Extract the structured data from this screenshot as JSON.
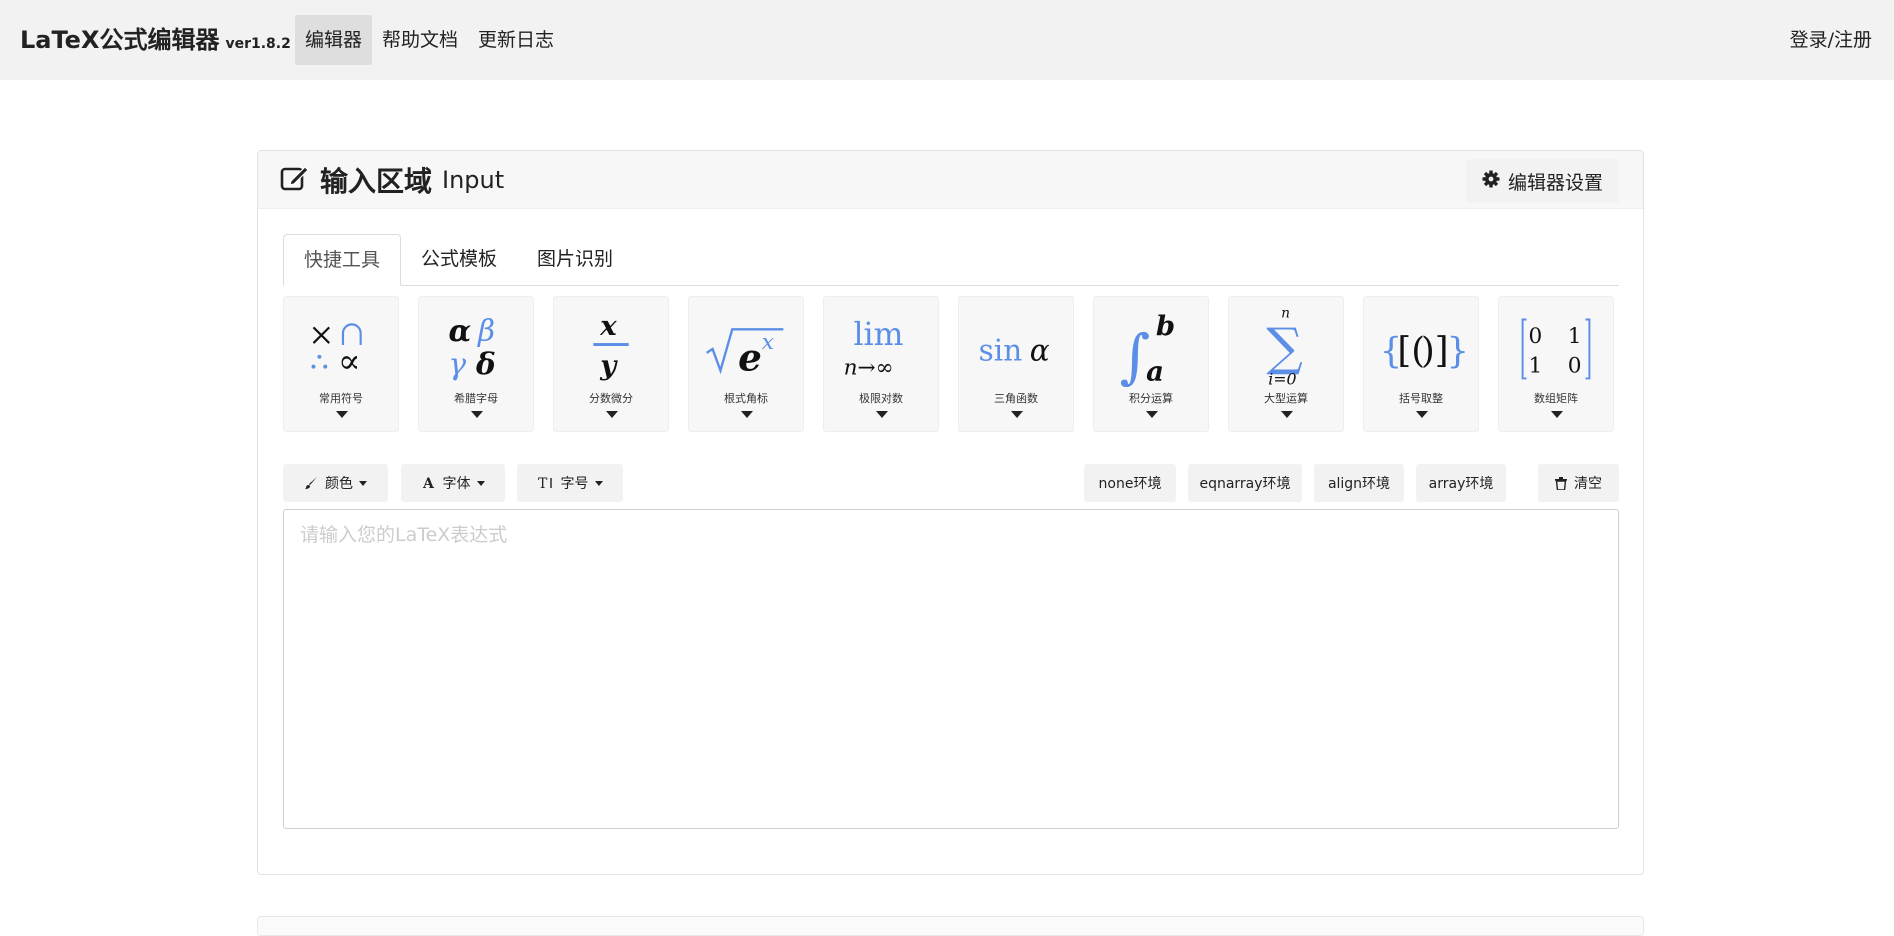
{
  "nav": {
    "brand_title": "LaTeX公式编辑器",
    "brand_version": "ver1.8.2",
    "links": [
      {
        "label": "编辑器",
        "active": true
      },
      {
        "label": "帮助文档",
        "active": false
      },
      {
        "label": "更新日志",
        "active": false
      }
    ],
    "login": "登录/注册"
  },
  "panel": {
    "title": "输入区域",
    "subtitle": "Input",
    "settings_label": "编辑器设置",
    "title_icon": "edit-icon",
    "settings_icon": "gear-icon"
  },
  "tabs": [
    {
      "label": "快捷工具",
      "active": true
    },
    {
      "label": "公式模板",
      "active": false
    },
    {
      "label": "图片识别",
      "active": false
    }
  ],
  "tools": [
    {
      "label": "常用符号",
      "icon": "common-symbols-icon"
    },
    {
      "label": "希腊字母",
      "icon": "greek-letters-icon"
    },
    {
      "label": "分数微分",
      "icon": "fraction-icon"
    },
    {
      "label": "根式角标",
      "icon": "root-superscript-icon"
    },
    {
      "label": "极限对数",
      "icon": "limit-icon"
    },
    {
      "label": "三角函数",
      "icon": "trig-icon"
    },
    {
      "label": "积分运算",
      "icon": "integral-icon"
    },
    {
      "label": "大型运算",
      "icon": "sum-icon"
    },
    {
      "label": "括号取整",
      "icon": "brackets-icon"
    },
    {
      "label": "数组矩阵",
      "icon": "matrix-icon"
    }
  ],
  "toolbar": {
    "color": "颜色",
    "font": "字体",
    "size": "字号",
    "env_none": "none环境",
    "env_eqnarray": "eqnarray环境",
    "env_align": "align环境",
    "env_array": "array环境",
    "clear": "清空"
  },
  "editor": {
    "placeholder": "请输入您的LaTeX表达式",
    "value": ""
  },
  "colors": {
    "accent_blue": "#5b8ee6",
    "nav_bg": "#f2f2f2"
  }
}
